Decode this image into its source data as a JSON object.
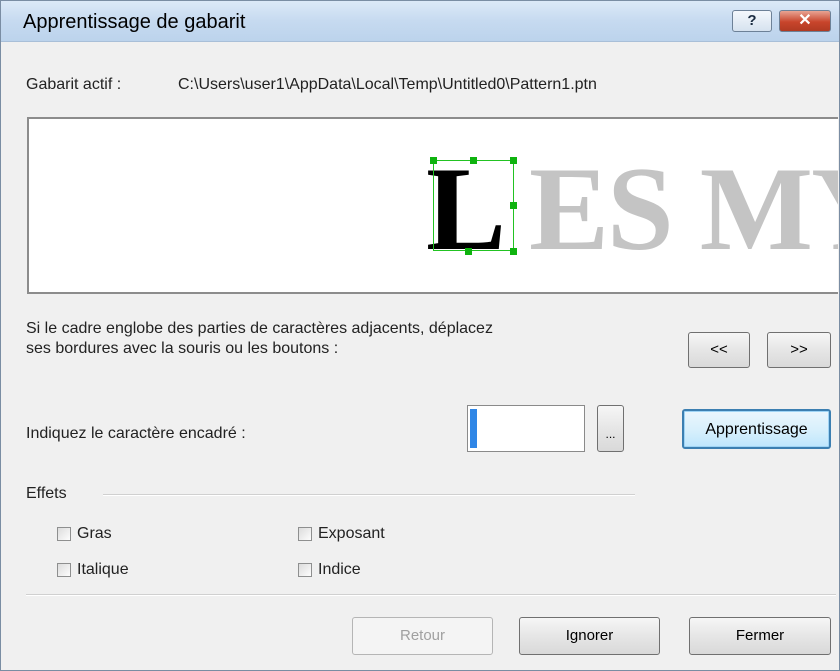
{
  "window": {
    "title": "Apprentissage de gabarit",
    "help_glyph": "?",
    "close_glyph": "✕"
  },
  "template": {
    "label": "Gabarit actif :",
    "path": "C:\\Users\\user1\\AppData\\Local\\Temp\\Untitled0\\Pattern1.ptn"
  },
  "preview": {
    "current_char": "L",
    "following_text": "ES MY"
  },
  "frame": {
    "instruction_line1": "Si le cadre englobe des parties de caractères adjacents, déplacez",
    "instruction_line2": "ses bordures avec la souris ou les boutons :",
    "prev_label": "<<",
    "next_label": ">>"
  },
  "character": {
    "label": "Indiquez le caractère encadré :",
    "value": "",
    "browse_label": "...",
    "learn_label": "Apprentissage"
  },
  "effects": {
    "label": "Effets",
    "bold": "Gras",
    "italic": "Italique",
    "superscript": "Exposant",
    "subscript": "Indice"
  },
  "buttons": {
    "back": "Retour",
    "ignore": "Ignorer",
    "close": "Fermer"
  },
  "colors": {
    "selection": "#22c322",
    "caret": "#2f86e6",
    "close_button": "#c8452c"
  }
}
